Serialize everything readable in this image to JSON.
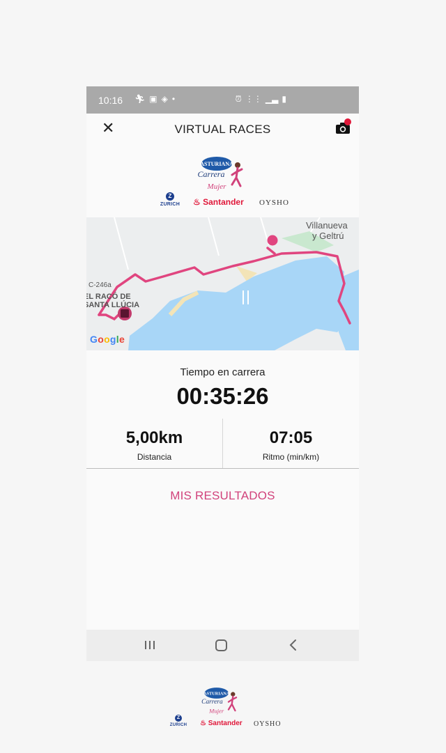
{
  "statusbar": {
    "time": "10:16"
  },
  "appbar": {
    "title": "VIRTUAL RACES"
  },
  "event": {
    "logo_brand": "ASTURIANA",
    "logo_script": "Carrera de la Mujer"
  },
  "sponsors": {
    "zurich": "ZURICH",
    "santander": "Santander",
    "oysho": "OYSHO"
  },
  "map": {
    "labels": {
      "town_line1": "Villanueva",
      "town_line2": "y Geltrú",
      "road": "C-246a",
      "place_line1": "EL RACÓ DE",
      "place_line2": "SANTA LLÚCIA"
    },
    "attribution": "Google",
    "route_color": "#e0457f",
    "water_color": "#a8d6f7"
  },
  "stats": {
    "time_label": "Tiempo en carrera",
    "time_value": "00:35:26",
    "distance_value": "5,00km",
    "distance_label": "Distancia",
    "pace_value": "07:05",
    "pace_label": "Ritmo (min/km)"
  },
  "actions": {
    "results": "MIS RESULTADOS"
  },
  "colors": {
    "accent": "#d1427b",
    "statusbar": "#a9a9a9"
  }
}
